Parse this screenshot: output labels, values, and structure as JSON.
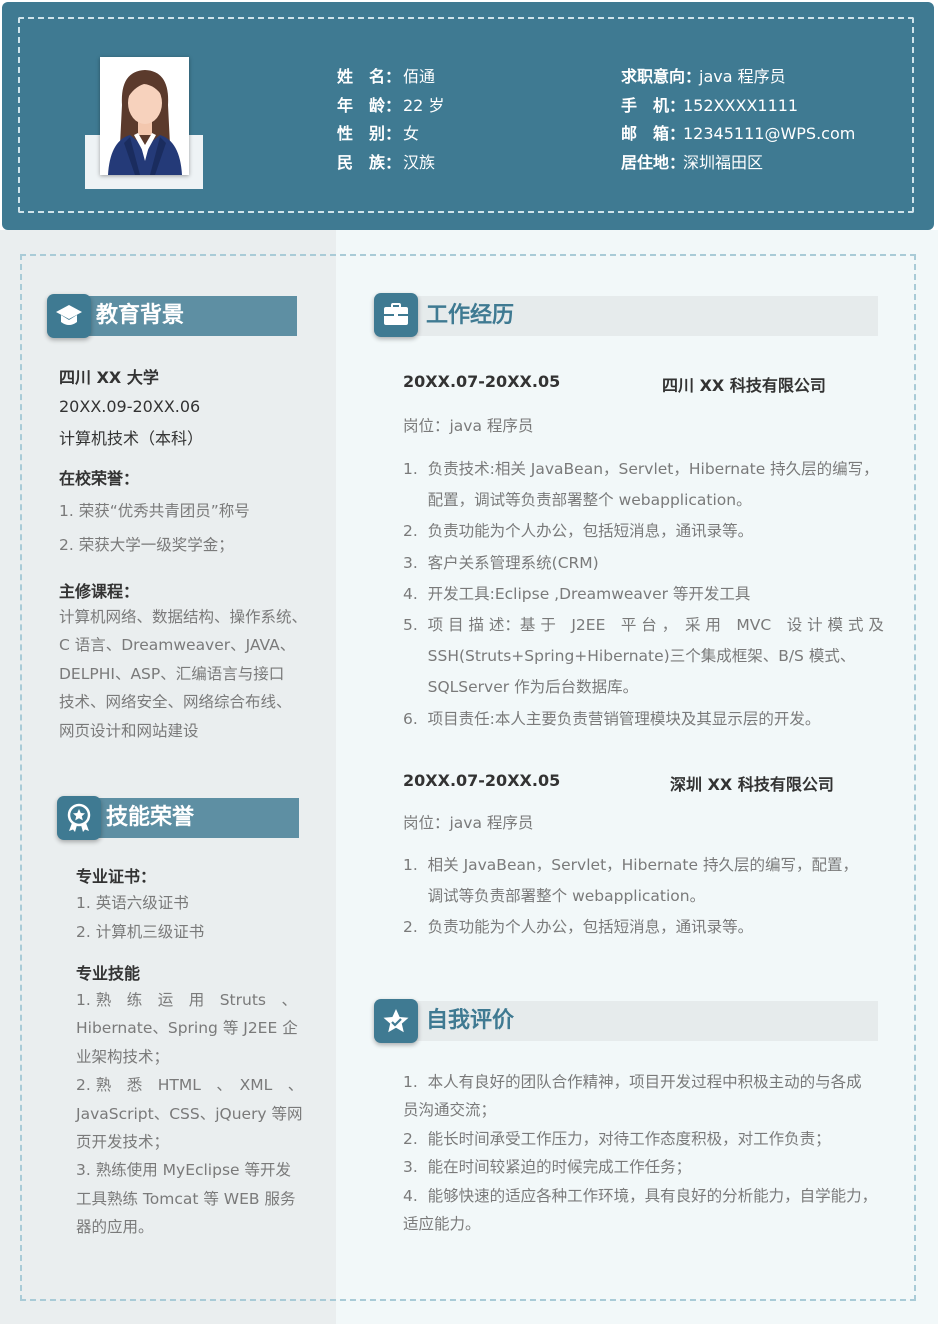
{
  "colors": {
    "header_bg": "#3f7a92",
    "accent_light": "#5e8fa3",
    "left_bg": "#eaeeef",
    "right_bg": "#f2f8f9",
    "heading_right": "#3f7a92"
  },
  "profile": {
    "photo_icon": "woman-avatar-icon",
    "left": [
      {
        "key": "姓　名：",
        "value": "佰通"
      },
      {
        "key": "年　龄：",
        "value": "22 岁"
      },
      {
        "key": "性　别：",
        "value": "女"
      },
      {
        "key": "民　族：",
        "value": "汉族"
      }
    ],
    "right": [
      {
        "key": "求职意向：",
        "value": "java 程序员"
      },
      {
        "key": "手　机：",
        "value": "152XXXX1111"
      },
      {
        "key": "邮　箱：",
        "value": "12345111@WPS.com"
      },
      {
        "key": "居住地：",
        "value": "深圳福田区"
      }
    ]
  },
  "education": {
    "title": "教育背景",
    "icon": "graduation-cap-icon",
    "school": "四川 XX 大学",
    "period": "20XX.09-20XX.06",
    "major": "计算机技术（本科）",
    "honors_title": "在校荣誉：",
    "honors": [
      "1.  荣获“优秀共青团员”称号",
      "2.  荣获大学一级奖学金；"
    ],
    "courses_title": "主修课程：",
    "courses_lines": [
      "计算机网络、数据结构、操作系统、",
      "C 语言、Dreamweaver、JAVA、",
      "DELPHI、ASP、汇编语言与接口",
      "技术、网络安全、网络综合布线、",
      "网页设计和网站建设"
    ]
  },
  "skills": {
    "title": "技能荣誉",
    "icon": "award-ribbon-icon",
    "cert_title": "专业证书：",
    "certs": [
      "1.  英语六级证书",
      "2.  计算机三级证书"
    ],
    "skill_title": "专业技能",
    "skill_lines": [
      "1. 熟　练　运　用　Struts　、",
      "Hibernate、Spring 等 J2EE 企",
      "业架构技术；",
      "2. 熟　悉　HTML　、　XML　、",
      "JavaScript、CSS、jQuery 等网",
      "页开发技术；",
      "3. 熟练使用 MyEclipse 等开发",
      "工具熟练 Tomcat 等 WEB 服务",
      "器的应用。"
    ]
  },
  "work": {
    "title": "工作经历",
    "icon": "briefcase-icon",
    "jobs": [
      {
        "period": "20XX.07-20XX.05",
        "company": "四川 XX 科技有限公司",
        "position": "岗位：java 程序员",
        "lines": [
          "1.  负责技术:相关 JavaBean，Servlet，Hibernate 持久层的编写，",
          "     配置，调试等负责部署整个 webapplication。",
          "2.  负责功能为个人办公，包括短消息，通讯录等。",
          "3.  客户关系管理系统(CRM)",
          "4.  开发工具:Eclipse ,Dreamweaver 等开发工具",
          "5.  项 目 描 述：基 于　J2EE　平 台 ，　采 用　MVC　设 计 模 式 及",
          "     SSH(Struts+Spring+Hibernate)三个集成框架、B/S 模式、",
          "     SQLServer 作为后台数据库。",
          "6.  项目责任:本人主要负责营销管理模块及其显示层的开发。"
        ]
      },
      {
        "period": "20XX.07-20XX.05",
        "company": "深圳 XX 科技有限公司",
        "position": "岗位：java 程序员",
        "lines": [
          "1.  相关 JavaBean，Servlet，Hibernate 持久层的编写，配置，",
          "     调试等负责部署整个 webapplication。",
          "2.  负责功能为个人办公，包括短消息，通讯录等。"
        ]
      }
    ]
  },
  "self_eval": {
    "title": "自我评价",
    "icon": "star-icon",
    "lines": [
      "1.  本人有良好的团队合作精神，项目开发过程中积极主动的与各成",
      "员沟通交流；",
      "2.  能长时间承受工作压力，对待工作态度积极，对工作负责；",
      "3.  能在时间较紧迫的时候完成工作任务；",
      "4.  能够快速的适应各种工作环境，具有良好的分析能力，自学能力，",
      "适应能力。"
    ]
  }
}
